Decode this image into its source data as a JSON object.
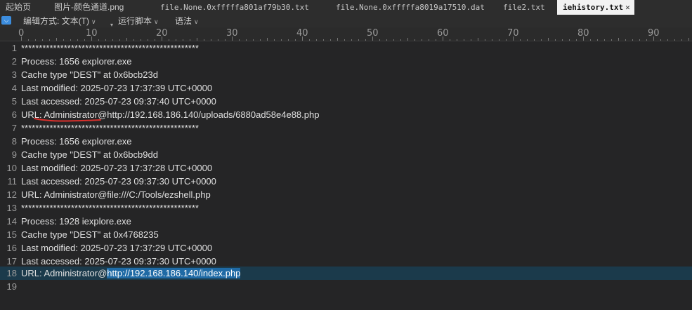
{
  "tabs": [
    {
      "label": "起始页"
    },
    {
      "label": "图片-颜色通道.png"
    },
    {
      "label": "file.None.0xfffffa801af79b30.txt"
    },
    {
      "label": "file.None.0xfffffa8019a17510.dat"
    },
    {
      "label": "file2.txt"
    },
    {
      "label": "iehistory.txt",
      "active": true,
      "close": "✕"
    }
  ],
  "toolbar": {
    "collapse_icon": "chevron-down",
    "edit_mode": "编辑方式: 文本(T)",
    "run_script": "运行脚本",
    "syntax": "语法"
  },
  "ruler": {
    "labels": [
      "0",
      "10",
      "20",
      "30",
      "40",
      "50",
      "60",
      "70",
      "80",
      "90"
    ]
  },
  "editor": {
    "lines": [
      {
        "n": "1",
        "text": "**************************************************"
      },
      {
        "n": "2",
        "text": "Process: 1656 explorer.exe"
      },
      {
        "n": "3",
        "text": "Cache type \"DEST\" at 0x6bcb23d"
      },
      {
        "n": "4",
        "text": "Last modified: 2025-07-23 17:37:39 UTC+0000"
      },
      {
        "n": "5",
        "text": "Last accessed: 2025-07-23 09:37:40 UTC+0000"
      },
      {
        "n": "6",
        "text": "URL: Administrator@http://192.168.186.140/uploads/6880ad58e4e88.php"
      },
      {
        "n": "7",
        "text": "**************************************************"
      },
      {
        "n": "8",
        "text": "Process: 1656 explorer.exe"
      },
      {
        "n": "9",
        "text": "Cache type \"DEST\" at 0x6bcb9dd"
      },
      {
        "n": "10",
        "text": "Last modified: 2025-07-23 17:37:28 UTC+0000"
      },
      {
        "n": "11",
        "text": "Last accessed: 2025-07-23 09:37:30 UTC+0000"
      },
      {
        "n": "12",
        "text": "URL: Administrator@file:///C:/Tools/ezshell.php"
      },
      {
        "n": "13",
        "text": "**************************************************"
      },
      {
        "n": "14",
        "text": "Process: 1928 iexplore.exe"
      },
      {
        "n": "15",
        "text": "Cache type \"DEST\" at 0x4768235"
      },
      {
        "n": "16",
        "text": "Last modified: 2025-07-23 17:37:29 UTC+0000"
      },
      {
        "n": "17",
        "text": "Last accessed: 2025-07-23 09:37:30 UTC+0000"
      },
      {
        "n": "18",
        "text": "URL: Administrator@",
        "selected": "http://192.168.186.140/index.php",
        "current": true
      },
      {
        "n": "19",
        "text": ""
      }
    ]
  },
  "annotation_color": "#d9302c",
  "selection_color": "#1f6aa5"
}
